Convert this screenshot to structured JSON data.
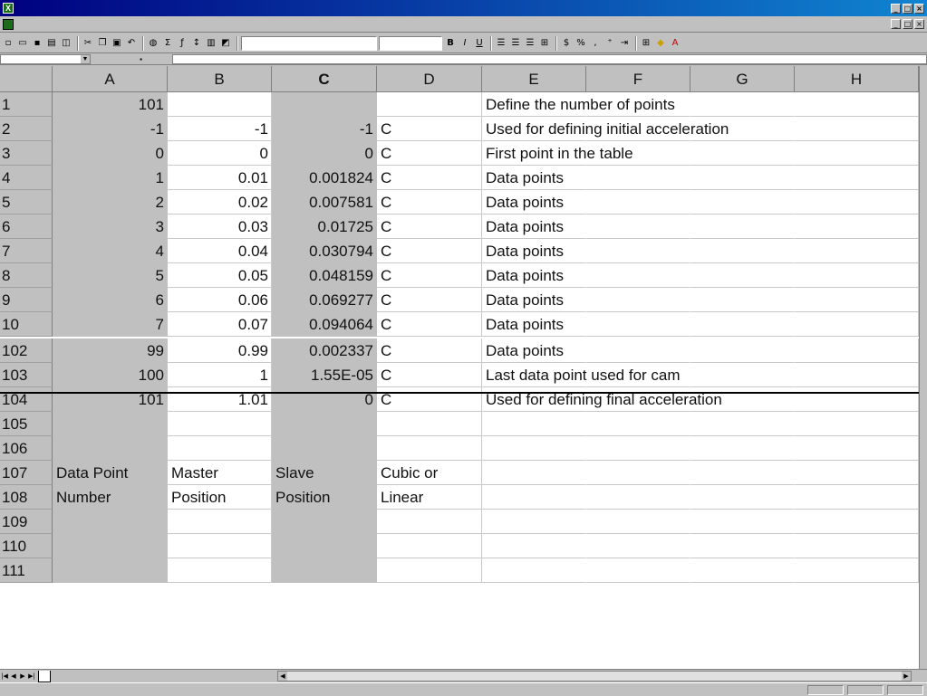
{
  "window": {
    "title": ""
  },
  "sheet": {
    "columns": [
      "A",
      "B",
      "C",
      "D",
      "E",
      "F",
      "G",
      "H"
    ],
    "rows": [
      {
        "num": "1",
        "a": "101",
        "b": "",
        "c": "",
        "d": "",
        "e": "Define the number of points"
      },
      {
        "num": "2",
        "a": "-1",
        "b": "-1",
        "c": "-1",
        "d": "C",
        "e": "Used for defining initial acceleration"
      },
      {
        "num": "3",
        "a": "0",
        "b": "0",
        "c": "0",
        "d": "C",
        "e": "First point in the table"
      },
      {
        "num": "4",
        "a": "1",
        "b": "0.01",
        "c": "0.001824",
        "d": "C",
        "e": "Data points"
      },
      {
        "num": "5",
        "a": "2",
        "b": "0.02",
        "c": "0.007581",
        "d": "C",
        "e": "Data points"
      },
      {
        "num": "6",
        "a": "3",
        "b": "0.03",
        "c": "0.01725",
        "d": "C",
        "e": "Data points"
      },
      {
        "num": "7",
        "a": "4",
        "b": "0.04",
        "c": "0.030794",
        "d": "C",
        "e": "Data points"
      },
      {
        "num": "8",
        "a": "5",
        "b": "0.05",
        "c": "0.048159",
        "d": "C",
        "e": "Data points"
      },
      {
        "num": "9",
        "a": "6",
        "b": "0.06",
        "c": "0.069277",
        "d": "C",
        "e": "Data points"
      },
      {
        "num": "10",
        "a": "7",
        "b": "0.07",
        "c": "0.094064",
        "d": "C",
        "e": "Data points"
      },
      {
        "num": "102",
        "a": "99",
        "b": "0.99",
        "c": "0.002337",
        "d": "C",
        "e": "Data points"
      },
      {
        "num": "103",
        "a": "100",
        "b": "1",
        "c": "1.55E-05",
        "d": "C",
        "e": "Last data point used for cam"
      },
      {
        "num": "104",
        "a": "101",
        "b": "1.01",
        "c": "0",
        "d": "C",
        "e": "Used for defining final acceleration"
      },
      {
        "num": "105",
        "a": "",
        "b": "",
        "c": "",
        "d": "",
        "e": ""
      },
      {
        "num": "106",
        "a": "",
        "b": "",
        "c": "",
        "d": "",
        "e": ""
      },
      {
        "num": "107",
        "a": "Data Point",
        "b": "Master",
        "c": "Slave",
        "d": "Cubic or",
        "e": ""
      },
      {
        "num": "108",
        "a": "Number",
        "b": "Position",
        "c": "Position",
        "d": "Linear",
        "e": ""
      },
      {
        "num": "109",
        "a": "",
        "b": "",
        "c": "",
        "d": "",
        "e": ""
      },
      {
        "num": "110",
        "a": "",
        "b": "",
        "c": "",
        "d": "",
        "e": ""
      },
      {
        "num": "111",
        "a": "",
        "b": "",
        "c": "",
        "d": "",
        "e": ""
      }
    ]
  },
  "colors": {
    "title_bar": "#000080",
    "shaded_column": "#c0c0c0"
  }
}
